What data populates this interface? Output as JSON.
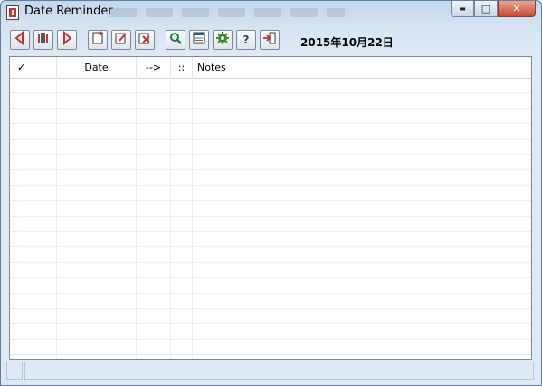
{
  "window": {
    "title": "Date Reminder",
    "buttons": {
      "minimize": "▬",
      "maximize": "□",
      "close": "✕"
    }
  },
  "toolbar": {
    "buttons": [
      {
        "name": "previous-button",
        "icon": "triangle-left-icon"
      },
      {
        "name": "today-button",
        "icon": "calendar-bars-icon"
      },
      {
        "name": "next-button",
        "icon": "triangle-right-icon"
      },
      {
        "name": "new-reminder-button",
        "icon": "new-document-icon"
      },
      {
        "name": "edit-reminder-button",
        "icon": "edit-document-icon"
      },
      {
        "name": "delete-reminder-button",
        "icon": "delete-document-icon"
      },
      {
        "name": "search-button",
        "icon": "magnifier-icon"
      },
      {
        "name": "list-view-button",
        "icon": "list-icon"
      },
      {
        "name": "settings-button",
        "icon": "gear-icon"
      },
      {
        "name": "help-button",
        "icon": "question-icon",
        "label": "?"
      },
      {
        "name": "exit-button",
        "icon": "exit-door-icon"
      }
    ],
    "current_date": "2015年10月22日"
  },
  "table": {
    "columns": [
      {
        "key": "done",
        "label": "✓"
      },
      {
        "key": "date",
        "label": "Date"
      },
      {
        "key": "arrow",
        "label": "-->"
      },
      {
        "key": "sep",
        "label": "::"
      },
      {
        "key": "notes",
        "label": "Notes"
      }
    ],
    "rows": []
  },
  "colors": {
    "accent_red": "#c33333",
    "accent_green": "#3a8a2a",
    "titlebar": "#c4d6ea"
  }
}
